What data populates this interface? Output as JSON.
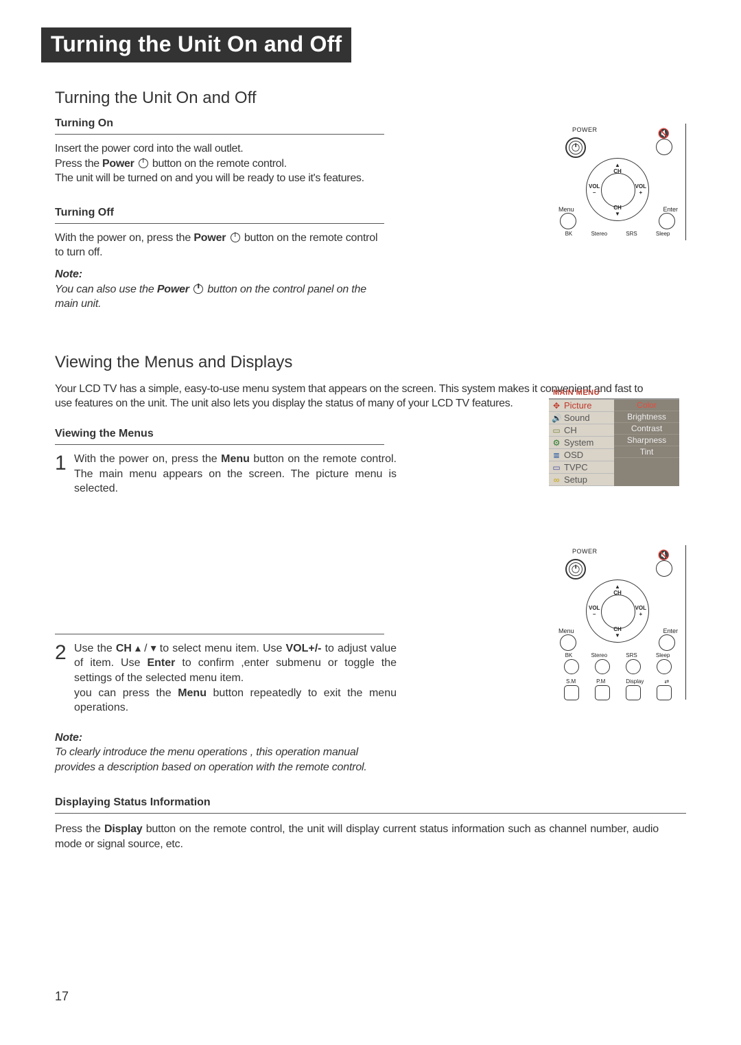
{
  "banner": "Turning the Unit On and Off",
  "h2_a": "Turning the Unit On and Off",
  "sub_on": "Turning On",
  "p_on_1": "Insert the power cord into the wall outlet.",
  "p_on_2a": "Press the ",
  "p_on_2b": "Power",
  "p_on_2c": " button on the remote control.",
  "p_on_3": "The unit will be turned on and you will be ready to use it's features.",
  "sub_off": "Turning Off",
  "p_off_a": "With the power on, press the ",
  "p_off_b": "Power",
  "p_off_c": " button on the remote control to turn off.",
  "note_label": "Note:",
  "note1_a": "You can also use the ",
  "note1_b": "Power",
  "note1_c": "  button on the control panel on the main unit.",
  "h2_b": "Viewing the Menus and Displays",
  "p_menus_intro": "Your LCD TV has a simple, easy-to-use menu system that appears on the screen. This system makes it convenient and fast to use features on the unit. The unit also lets you display the status of many of your LCD TV features.",
  "sub_viewing": "Viewing the Menus",
  "step1_a": "With the power on, press the ",
  "step1_b": "Menu",
  "step1_c": " button on the remote control. The main menu appears on the screen. The picture menu is selected.",
  "step2_a": "Use the ",
  "step2_b": "CH",
  "step2_c": " to select menu item. Use ",
  "step2_d": "VOL+/-",
  "step2_e": " to adjust value  of item. Use ",
  "step2_f": "Enter",
  "step2_g": " to confirm ,enter submenu or toggle the settings of the selected menu item.",
  "step2_h": "you can press the ",
  "step2_i": "Menu",
  "step2_j": " button repeatedly to exit the menu operations.",
  "step2_arrows": " ▴ / ▾ ",
  "note2": "To clearly introduce the menu operations , this operation manual provides a description based on operation with the remote control.",
  "sub_display": "Displaying Status Information",
  "p_display_a": "Press the ",
  "p_display_b": "Display",
  "p_display_c": " button on the remote control, the unit will display current status information such as channel number, audio mode or signal source, etc.",
  "page_number": "17",
  "remote": {
    "power_label": "POWER",
    "ch": "CH",
    "vol": "VOL",
    "plus": "+",
    "minus": "–",
    "menu": "Menu",
    "enter": "Enter",
    "row4": [
      "BK",
      "Stereo",
      "SRS",
      "Sleep"
    ],
    "row5": [
      "S.M",
      "P.M",
      "Display",
      ""
    ],
    "swap_icon": "⇄"
  },
  "osd": {
    "title": "MAIN MENU",
    "left": [
      {
        "icon": "✥",
        "label": "Picture",
        "sel": true,
        "icon_color": "#c0392b"
      },
      {
        "icon": "🔊",
        "label": "Sound",
        "sel": false,
        "icon_color": "#c9a400"
      },
      {
        "icon": "▭",
        "label": "CH",
        "sel": false,
        "icon_color": "#7a8a3a"
      },
      {
        "icon": "⚙",
        "label": "System",
        "sel": false,
        "icon_color": "#2a7a2a"
      },
      {
        "icon": "≣",
        "label": "OSD",
        "sel": false,
        "icon_color": "#2a5aa0"
      },
      {
        "icon": "▭",
        "label": "TVPC",
        "sel": false,
        "icon_color": "#4a4aa0"
      },
      {
        "icon": "∞",
        "label": "Setup",
        "sel": false,
        "icon_color": "#c9a400"
      }
    ],
    "right": [
      "Color",
      "Brightness",
      "Contrast",
      "Sharpness",
      "Tint"
    ]
  }
}
